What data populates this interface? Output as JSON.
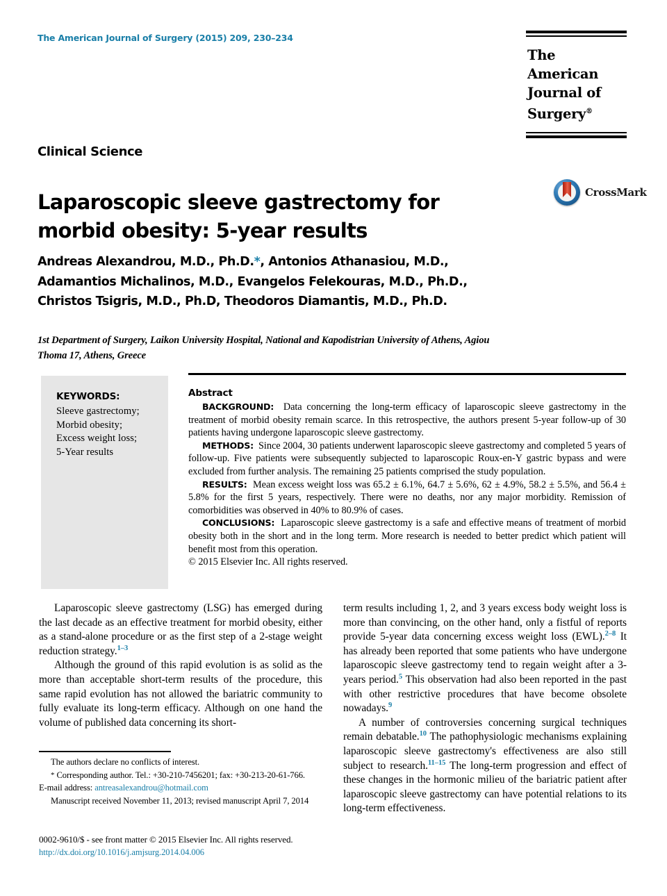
{
  "header": {
    "journal_reference": "The American Journal of Surgery (2015) 209, 230–234",
    "logo_line1": "The American",
    "logo_line2": "Journal of Surgery",
    "logo_registered": "®"
  },
  "article": {
    "kicker": "Clinical Science",
    "title": "Laparoscopic sleeve gastrectomy for morbid obesity: 5-year results",
    "crossmark_label": "CrossMark",
    "crossmark_icon": "crossmark-logo-icon",
    "authors_line1_pre": "Andreas Alexandrou, M.D., Ph.D.",
    "authors_star": "*",
    "authors_line1_post": ", Antonios Athanasiou, M.D.,",
    "authors_line2": "Adamantios Michalinos, M.D., Evangelos Felekouras, M.D., Ph.D.,",
    "authors_line3": "Christos Tsigris, M.D., Ph.D, Theodoros Diamantis, M.D., Ph.D.",
    "affiliation": "1st Department of Surgery, Laikon University Hospital, National and Kapodistrian University of Athens, Agiou Thoma 17, Athens, Greece"
  },
  "keywords": {
    "heading": "KEYWORDS:",
    "items": [
      "Sleeve gastrectomy;",
      "Morbid obesity;",
      "Excess weight loss;",
      "5-Year results"
    ]
  },
  "abstract": {
    "heading": "Abstract",
    "background_label": "BACKGROUND:",
    "background_text": "Data concerning the long-term efficacy of laparoscopic sleeve gastrectomy in the treatment of morbid obesity remain scarce. In this retrospective, the authors present 5-year follow-up of 30 patients having undergone laparoscopic sleeve gastrectomy.",
    "methods_label": "METHODS:",
    "methods_text": "Since 2004, 30 patients underwent laparoscopic sleeve gastrectomy and completed 5 years of follow-up. Five patients were subsequently subjected to laparoscopic Roux-en-Y gastric bypass and were excluded from further analysis. The remaining 25 patients comprised the study population.",
    "results_label": "RESULTS:",
    "results_text": "Mean excess weight loss was 65.2 ± 6.1%, 64.7 ± 5.6%, 62 ± 4.9%, 58.2 ± 5.5%, and 56.4 ± 5.8% for the first 5 years, respectively. There were no deaths, nor any major morbidity. Remission of comorbidities was observed in 40% to 80.9% of cases.",
    "conclusions_label": "CONCLUSIONS:",
    "conclusions_text": "Laparoscopic sleeve gastrectomy is a safe and effective means of treatment of morbid obesity both in the short and in the long term. More research is needed to better predict which patient will benefit most from this operation.",
    "copyright": "© 2015 Elsevier Inc. All rights reserved."
  },
  "body": {
    "left_para1_a": "Laparoscopic sleeve gastrectomy (LSG) has emerged during the last decade as an effective treatment for morbid obesity, either as a stand-alone procedure or as the first step of a 2-stage weight reduction strategy.",
    "left_para1_ref": "1–3",
    "left_para2": "Although the ground of this rapid evolution is as solid as the more than acceptable short-term results of the procedure, this same rapid evolution has not allowed the bariatric community to fully evaluate its long-term efficacy. Although on one hand the volume of published data concerning its short-",
    "right_para1_a": "term results including 1, 2, and 3 years excess body weight loss is more than convincing, on the other hand, only a fistful of reports provide 5-year data concerning excess weight loss (EWL).",
    "right_para1_ref1": "2–8",
    "right_para1_b": "It has already been reported that some patients who have undergone laparoscopic sleeve gastrectomy tend to regain weight after a 3-years period.",
    "right_para1_ref2": "5",
    "right_para1_c": "This observation had also been reported in the past with other restrictive procedures that have become obsolete nowadays.",
    "right_para1_ref3": "9",
    "right_para2_a": "A number of controversies concerning surgical techniques remain debatable.",
    "right_para2_ref1": "10",
    "right_para2_b": "The pathophysiologic mechanisms explaining laparoscopic sleeve gastrectomy's effectiveness are also still subject to research.",
    "right_para2_ref2": "11–15",
    "right_para2_c": "The long-term progression and effect of these changes in the hormonic milieu of the bariatric patient after laparoscopic sleeve gastrectomy can have potential relations to its long-term effectiveness."
  },
  "footnote": {
    "conflicts": "The authors declare no conflicts of interest.",
    "corresponding_star": "*",
    "corresponding": "Corresponding author. Tel.: +30-210-7456201; fax: +30-213-20-61-766.",
    "email_label": "E-mail address:",
    "email": "antreasalexandrou@hotmail.com",
    "manuscript_dates": "Manuscript received November 11, 2013; revised manuscript April 7, 2014"
  },
  "bottom": {
    "issn_line": "0002-9610/$ - see front matter © 2015 Elsevier Inc. All rights reserved.",
    "doi": "http://dx.doi.org/10.1016/j.amjsurg.2014.04.006"
  },
  "colors": {
    "accent_blue": "#1a7fa8",
    "keywords_bg": "#e6e6e6",
    "text": "#000000"
  }
}
